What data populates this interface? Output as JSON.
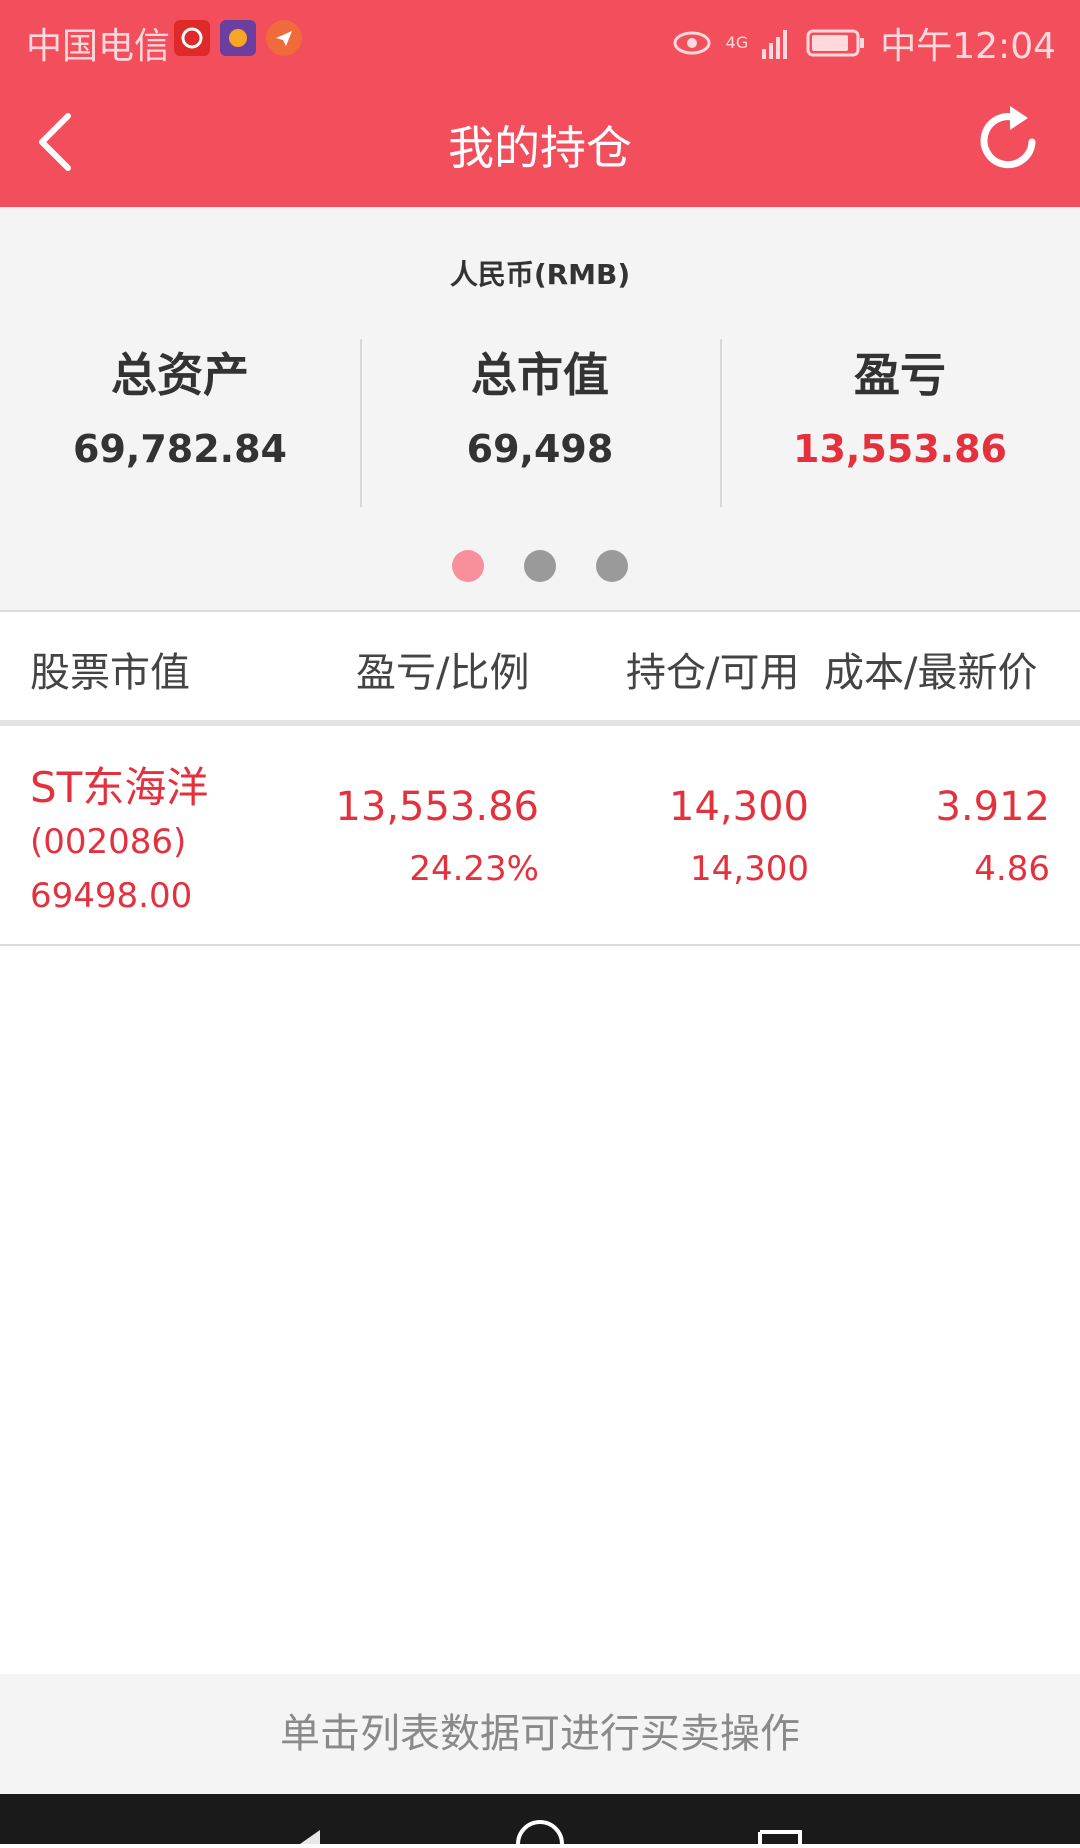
{
  "status_bar": {
    "carrier": "中国电信",
    "network": "4G",
    "time": "中午12:04"
  },
  "nav": {
    "title": "我的持仓"
  },
  "summary": {
    "currency": "人民币(RMB)",
    "stats": [
      {
        "label": "总资产",
        "value": "69,782.84"
      },
      {
        "label": "总市值",
        "value": "69,498"
      },
      {
        "label": "盈亏",
        "value": "13,553.86"
      }
    ],
    "page_index": 1,
    "page_count": 3
  },
  "table": {
    "headers": [
      "股票市值",
      "盈亏/比例",
      "持仓/可用",
      "成本/最新价"
    ],
    "rows": [
      {
        "name": "ST东海洋",
        "code": "(002086)",
        "market_value": "69498.00",
        "profit": "13,553.86",
        "ratio": "24.23%",
        "holding": "14,300",
        "available": "14,300",
        "cost": "3.912",
        "latest": "4.86"
      }
    ]
  },
  "footer": {
    "hint": "单击列表数据可进行买卖操作"
  },
  "colors": {
    "brand": "#f34e5c",
    "profit_red": "#e3313d"
  }
}
